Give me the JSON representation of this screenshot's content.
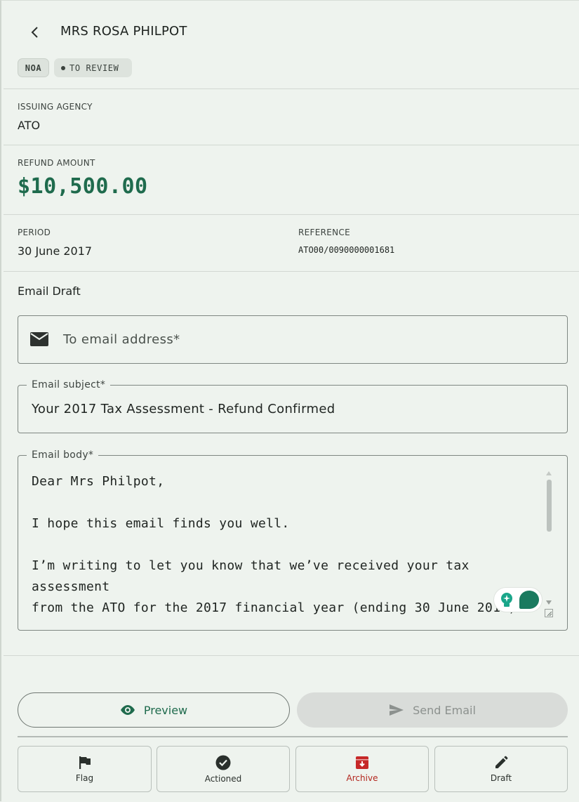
{
  "header": {
    "title": "MRS ROSA PHILPOT",
    "tags": {
      "doc_type": "NOA",
      "status": "TO REVIEW"
    }
  },
  "details": {
    "issuing_agency_label": "ISSUING AGENCY",
    "issuing_agency_value": "ATO",
    "refund_amount_label": "REFUND AMOUNT",
    "refund_amount_value": "$10,500.00",
    "period_label": "PERIOD",
    "period_value": "30 June 2017",
    "reference_label": "REFERENCE",
    "reference_value": "ATO00/0090000001681"
  },
  "email": {
    "section_title": "Email Draft",
    "to_placeholder": "To email address*",
    "subject_label": "Email subject*",
    "subject_value": "Your 2017 Tax Assessment - Refund Confirmed",
    "body_label": "Email body*",
    "body_value": "Dear Mrs Philpot,\n\nI hope this email finds you well.\n\nI’m writing to let you know that we’ve received your tax assessment\nfrom the ATO for the 2017 financial year (ending 30 June 2017)."
  },
  "buttons": {
    "preview": "Preview",
    "send": "Send Email"
  },
  "actions": [
    {
      "label": "Flag",
      "icon": "flag-icon"
    },
    {
      "label": "Actioned",
      "icon": "check-circle-icon"
    },
    {
      "label": "Archive",
      "icon": "archive-icon"
    },
    {
      "label": "Draft",
      "icon": "pencil-icon"
    }
  ],
  "colors": {
    "accent": "#1f6b4d",
    "background": "#eef3ee",
    "archive": "#b3261e",
    "disabled": "#d9dcd9"
  }
}
